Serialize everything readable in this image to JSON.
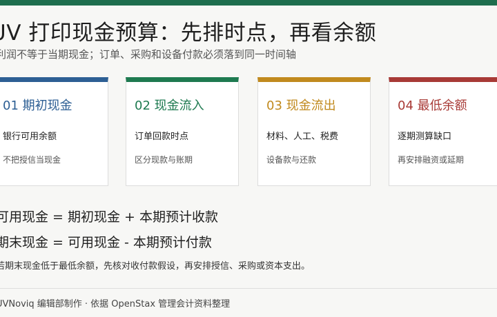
{
  "header": {
    "title": "UV 打印现金预算：先排时点，再看余额",
    "subtitle": "利润不等于当期现金；订单、采购和设备付款必须落到同一时间轴"
  },
  "cards": [
    {
      "title": "01 期初现金",
      "item": "银行可用余额",
      "note": "不把授信当现金",
      "accent": "#2d5f94"
    },
    {
      "title": "02 现金流入",
      "item": "订单回款时点",
      "note": "区分现款与账期",
      "accent": "#1e7a50"
    },
    {
      "title": "03 现金流出",
      "item": "材料、人工、税费",
      "note": "设备款与还款",
      "accent": "#c18a1e"
    },
    {
      "title": "04 最低余额",
      "item": "逐期测算缺口",
      "note": "再安排融资或延期",
      "accent": "#a83a36"
    }
  ],
  "formulas": {
    "line1": "可用现金 = 期初现金 + 本期预计收款",
    "line2": "期末现金 = 可用现金 - 本期预计付款",
    "advice": "若期末现金低于最低余额，先核对收付款假设，再安排授信、采购或资本支出。"
  },
  "footer": {
    "credit": "UVNoviq 编辑部制作 · 依据 OpenStax 管理会计资料整理"
  },
  "colors": {
    "top_bar": "#1e6e4e",
    "background": "#f7f7f5"
  }
}
